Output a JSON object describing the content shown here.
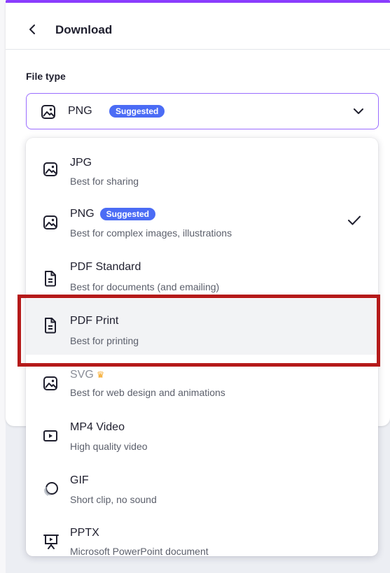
{
  "header": {
    "title": "Download"
  },
  "file_type": {
    "label": "File type",
    "selected_value": "PNG",
    "selected_badge": "Suggested"
  },
  "options": [
    {
      "name": "JPG",
      "description": "Best for sharing",
      "icon": "image-icon"
    },
    {
      "name": "PNG",
      "badge": "Suggested",
      "description": "Best for complex images, illustrations",
      "icon": "image-icon",
      "selected": true
    },
    {
      "name": "PDF Standard",
      "description": "Best for documents (and emailing)",
      "icon": "document-icon"
    },
    {
      "name": "PDF Print",
      "description": "Best for printing",
      "icon": "document-icon",
      "hovered": true
    },
    {
      "name": "SVG",
      "description": "Best for web design and animations",
      "icon": "image-icon",
      "premium": "crown-icon"
    },
    {
      "name": "MP4 Video",
      "description": "High quality video",
      "icon": "video-icon"
    },
    {
      "name": "GIF",
      "description": "Short clip, no sound",
      "icon": "gif-icon"
    },
    {
      "name": "PPTX",
      "description": "Microsoft PowerPoint document",
      "icon": "presentation-icon"
    }
  ],
  "colors": {
    "accent": "#8b3dff",
    "badge": "#4b6cf5",
    "annotation": "#b51a1a",
    "crown": "#f5a623"
  }
}
